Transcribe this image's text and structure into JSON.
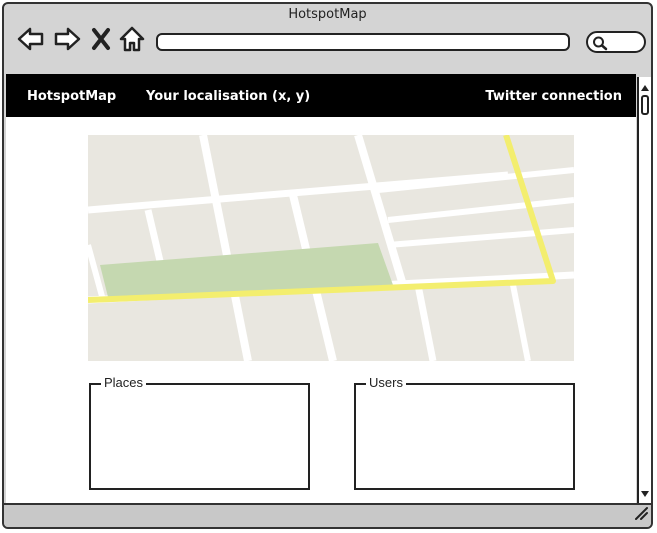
{
  "window": {
    "title": "HotspotMap"
  },
  "toolbar": {
    "back_icon": "arrow-left-icon",
    "forward_icon": "arrow-right-icon",
    "stop_icon": "close-icon",
    "home_icon": "home-icon",
    "address_value": "",
    "search_icon": "search-icon"
  },
  "navbar": {
    "brand": "HotspotMap",
    "localisation": "Your localisation (x, y)",
    "twitter": "Twitter connection"
  },
  "panels": {
    "places_label": "Places",
    "users_label": "Users"
  },
  "colors": {
    "navbar_bg": "#000000",
    "map_bg": "#e9e7e0",
    "road": "#ffffff",
    "highway": "#f3ee6e",
    "park": "#c5d8b0"
  }
}
